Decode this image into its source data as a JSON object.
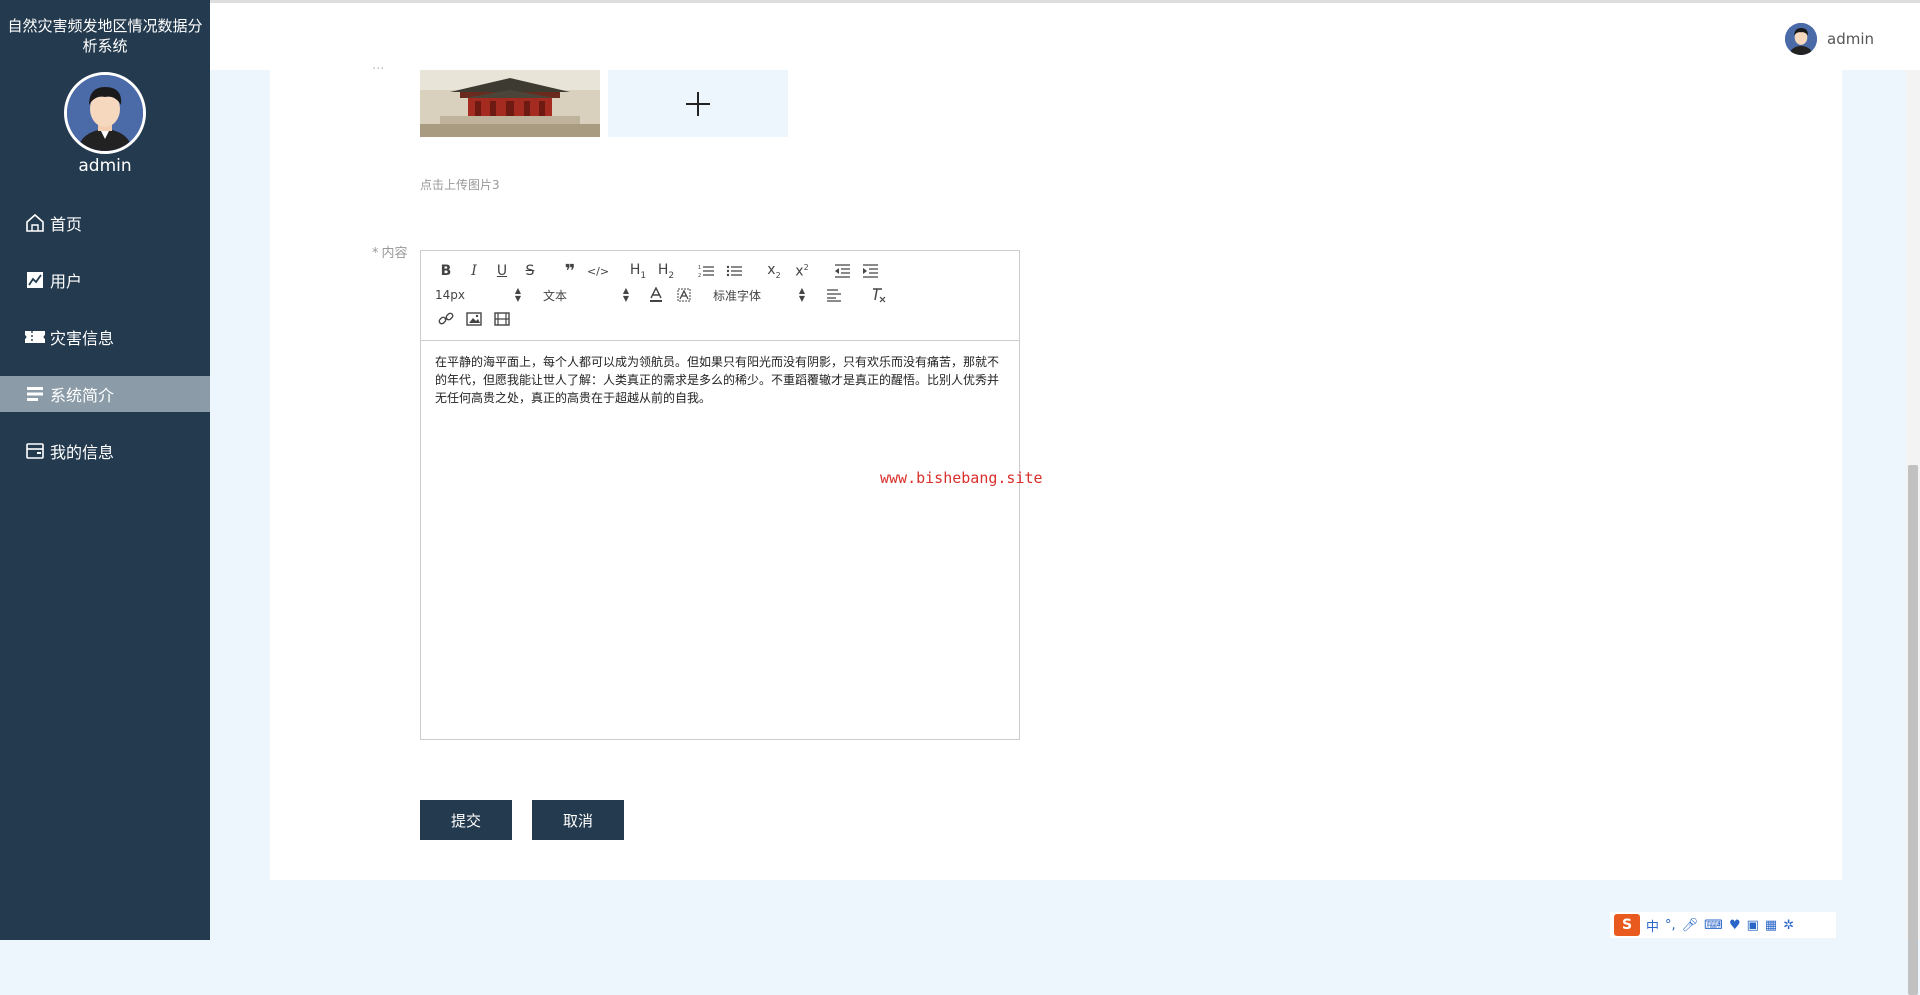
{
  "sidebar": {
    "title": "自然灾害频发地区情况数据分析系统",
    "username": "admin",
    "items": [
      {
        "label": "首页",
        "icon": "home-icon"
      },
      {
        "label": "用户",
        "icon": "chart-line-icon"
      },
      {
        "label": "灾害信息",
        "icon": "ticket-icon"
      },
      {
        "label": "系统简介",
        "icon": "list-icon",
        "active": true
      },
      {
        "label": "我的信息",
        "icon": "wallet-icon"
      }
    ]
  },
  "topbar": {
    "username": "admin"
  },
  "form": {
    "upload_tip": "点击上传图片3",
    "content_label": "内容",
    "required_mark": "*",
    "editor": {
      "font_size": "14px",
      "block_format": "文本",
      "font_family": "标准字体",
      "content": "在平静的海平面上，每个人都可以成为领航员。但如果只有阳光而没有阴影，只有欢乐而没有痛苦，那就不的年代，但愿我能让世人了解：人类真正的需求是多么的稀少。不重蹈覆辙才是真正的醒悟。比别人优秀并无任何高贵之处，真正的高贵在于超越从前的自我。"
    },
    "submit_label": "提交",
    "cancel_label": "取消"
  },
  "watermark": "www.bishebang.site",
  "ime": {
    "lang": "中"
  }
}
